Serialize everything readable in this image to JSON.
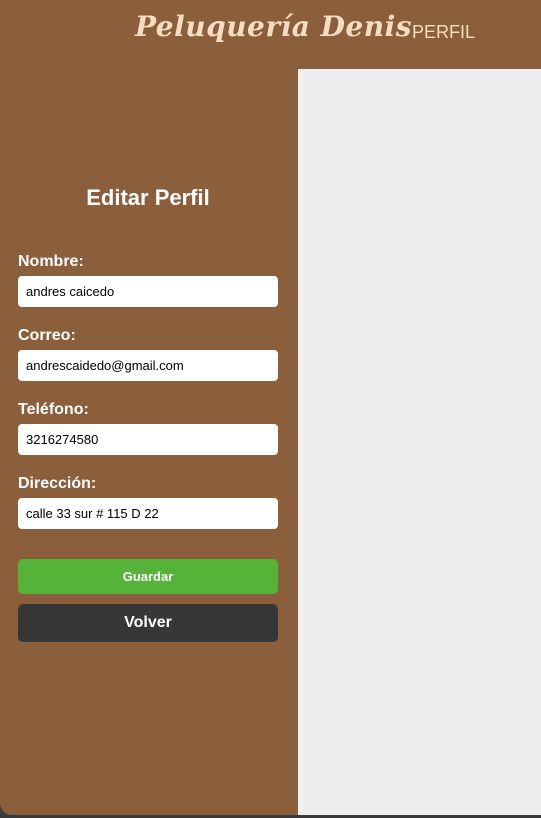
{
  "header": {
    "brand": "Peluquería Denis",
    "nav_profile": "PERFIL"
  },
  "form": {
    "title": "Editar Perfil",
    "fields": [
      {
        "label": "Nombre:",
        "value": "andres caicedo"
      },
      {
        "label": "Correo:",
        "value": "andrescaidedo@gmail.com"
      },
      {
        "label": "Teléfono:",
        "value": "3216274580"
      },
      {
        "label": "Dirección:",
        "value": "calle 33 sur # 115 D 22"
      }
    ],
    "save_label": "Guardar",
    "back_label": "Volver"
  },
  "colors": {
    "sidebar": "#8b5e3c",
    "content": "#eceef0",
    "save": "#55b33a",
    "back": "#373737",
    "brand_text": "#f6dcc0"
  }
}
